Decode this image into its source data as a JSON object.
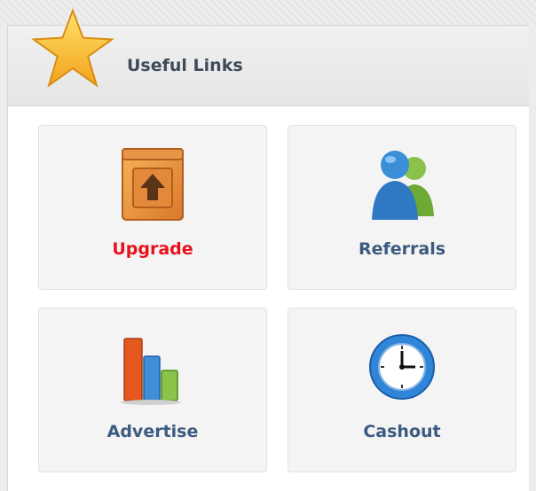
{
  "header": {
    "title": "Useful Links"
  },
  "tiles": [
    {
      "label": "Upgrade",
      "icon": "upgrade-box-icon",
      "color": "#e8111b"
    },
    {
      "label": "Referrals",
      "icon": "users-icon",
      "color": "#3d5a80"
    },
    {
      "label": "Advertise",
      "icon": "bar-chart-icon",
      "color": "#3d5a80"
    },
    {
      "label": "Cashout",
      "icon": "clock-icon",
      "color": "#3d5a80"
    }
  ]
}
